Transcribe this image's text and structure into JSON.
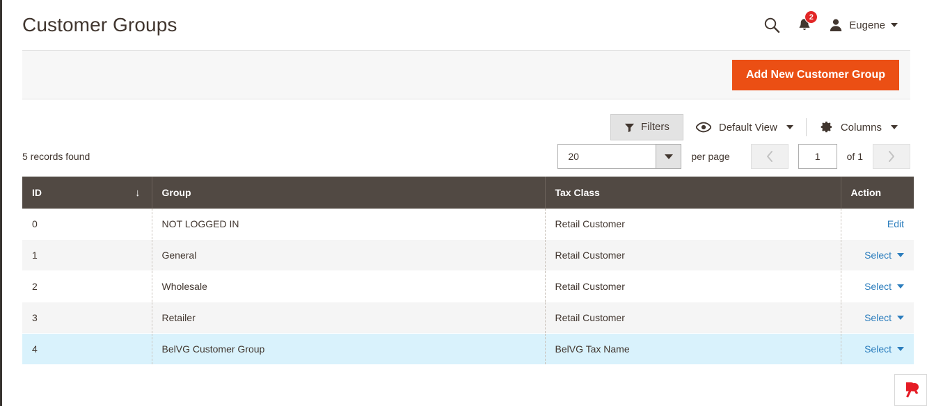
{
  "header": {
    "title": "Customer Groups",
    "search_icon": "search-icon",
    "notifications": {
      "icon": "bell-icon",
      "count": "2"
    },
    "user": {
      "icon": "user-avatar-icon",
      "name": "Eugene",
      "caret": "chevron-down-icon"
    }
  },
  "page_actions": {
    "add_button_label": "Add New Customer Group",
    "add_button_color": "#eb4f14"
  },
  "toolbar": {
    "filters_label": "Filters",
    "filters_icon": "funnel-icon",
    "view_label": "Default View",
    "view_icon": "eye-icon",
    "columns_label": "Columns",
    "columns_icon": "gear-icon"
  },
  "grid_meta": {
    "records_found": "5 records found",
    "per_page_value": "20",
    "per_page_label": "per page",
    "current_page": "1",
    "of_label": "of 1",
    "prev_icon": "chevron-left-icon",
    "next_icon": "chevron-right-icon"
  },
  "table": {
    "columns": [
      {
        "label": "ID",
        "sort": "↓"
      },
      {
        "label": "Group",
        "sort": ""
      },
      {
        "label": "Tax Class",
        "sort": ""
      },
      {
        "label": "Action",
        "sort": ""
      }
    ],
    "rows": [
      {
        "id": "0",
        "group": "NOT LOGGED IN",
        "tax_class": "Retail Customer",
        "action": "Edit",
        "action_type": "link",
        "state": "odd"
      },
      {
        "id": "1",
        "group": "General",
        "tax_class": "Retail Customer",
        "action": "Select",
        "action_type": "select",
        "state": "even"
      },
      {
        "id": "2",
        "group": "Wholesale",
        "tax_class": "Retail Customer",
        "action": "Select",
        "action_type": "select",
        "state": "odd"
      },
      {
        "id": "3",
        "group": "Retailer",
        "tax_class": "Retail Customer",
        "action": "Select",
        "action_type": "select",
        "state": "even"
      },
      {
        "id": "4",
        "group": "BelVG Customer Group",
        "tax_class": "BelVG Tax Name",
        "action": "Select",
        "action_type": "select",
        "state": "selected"
      }
    ]
  },
  "corner": {
    "logo_icon": "belvg-logo-icon",
    "color": "#e51b24"
  },
  "colors": {
    "accent": "#eb4f14",
    "header_row": "#514943",
    "link": "#2b7dbd",
    "selected_row": "#d9f2fc",
    "badge": "#e22626"
  }
}
